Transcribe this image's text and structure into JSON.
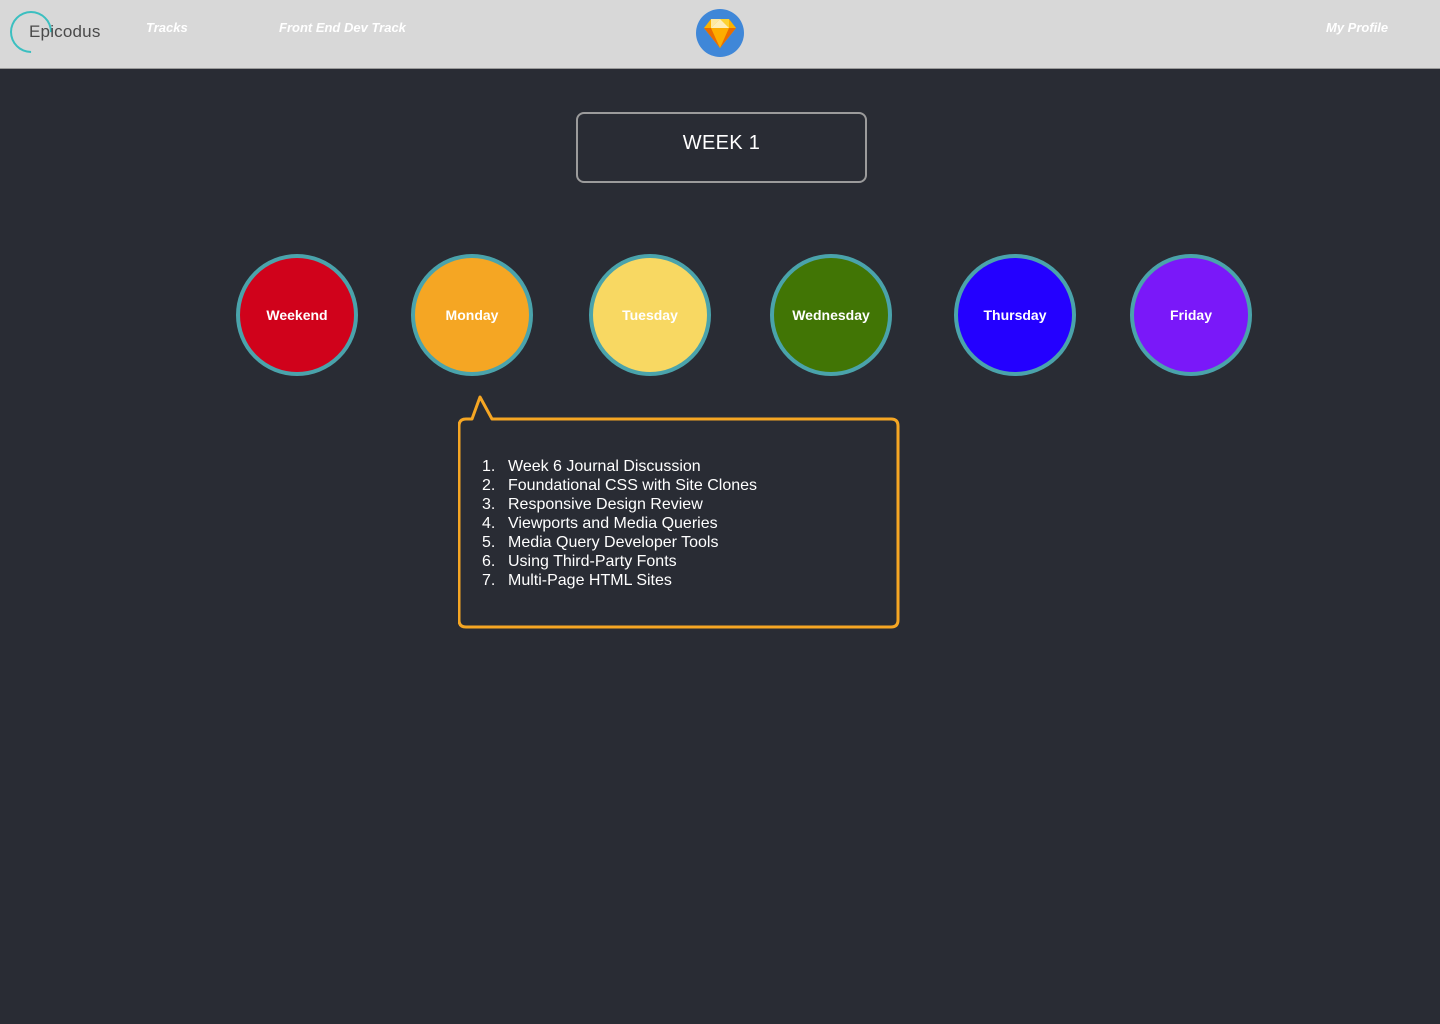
{
  "header": {
    "logo_text": "Epicodus",
    "nav": {
      "tracks": "Tracks",
      "track_name": "Front End Dev Track",
      "profile": "My Profile"
    },
    "center_icon": "sketch-diamond-icon"
  },
  "week": {
    "title": "WEEK 1"
  },
  "days": [
    {
      "label": "Weekend",
      "color": "#d0021b"
    },
    {
      "label": "Monday",
      "color": "#f5a623"
    },
    {
      "label": "Tuesday",
      "color": "#f8d862"
    },
    {
      "label": "Wednesday",
      "color": "#417505"
    },
    {
      "label": "Thursday",
      "color": "#2400ff"
    },
    {
      "label": "Friday",
      "color": "#7a18f9"
    }
  ],
  "popover": {
    "border_color": "#f5a623",
    "items": [
      {
        "num": "1.",
        "text": "Week 6 Journal Discussion"
      },
      {
        "num": "2.",
        "text": "Foundational CSS with Site Clones"
      },
      {
        "num": "3.",
        "text": "Responsive Design Review"
      },
      {
        "num": "4.",
        "text": "Viewports and Media Queries"
      },
      {
        "num": "5.",
        "text": "Media Query Developer Tools"
      },
      {
        "num": "6.",
        "text": "Using Third-Party Fonts"
      },
      {
        "num": "7.",
        "text": "Multi-Page HTML Sites"
      }
    ]
  }
}
